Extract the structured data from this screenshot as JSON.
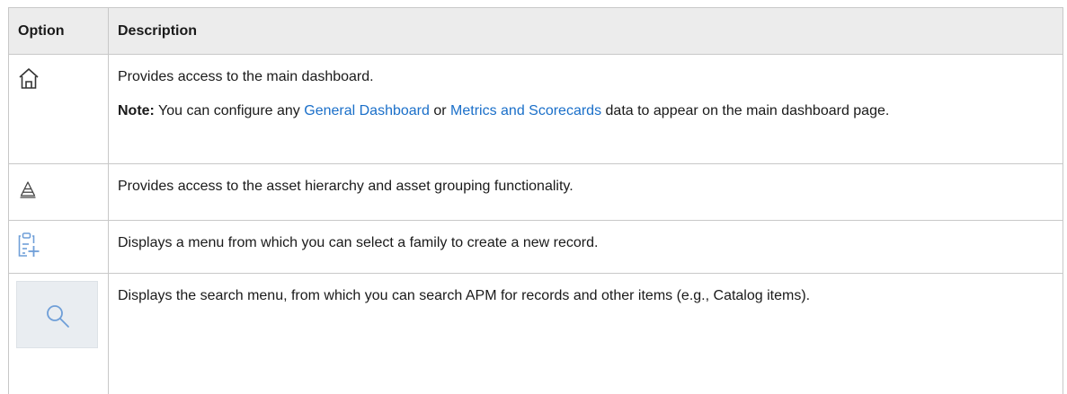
{
  "table": {
    "headers": {
      "option": "Option",
      "description": "Description"
    },
    "rows": [
      {
        "icon": "home-icon",
        "description": "Provides access to the main dashboard.",
        "note_label": "Note:",
        "note_text_1": " You can configure any ",
        "link_1": "General Dashboard",
        "note_text_2": " or ",
        "link_2": "Metrics and Scorecards",
        "note_text_3": " data to appear on the main dashboard page."
      },
      {
        "icon": "asset-hierarchy-icon",
        "description": "Provides access to the asset hierarchy and asset grouping functionality."
      },
      {
        "icon": "new-record-icon",
        "description": "Displays a menu from which you can select a family to create a new record."
      },
      {
        "icon": "search-icon",
        "description": "Displays the search menu, from which you can search APM for records and other items (e.g., Catalog items)."
      }
    ]
  },
  "colors": {
    "link": "#1a6fc9",
    "header_bg": "#ececec",
    "border": "#c8c8c8",
    "icon_blue": "#6f9fd8"
  }
}
